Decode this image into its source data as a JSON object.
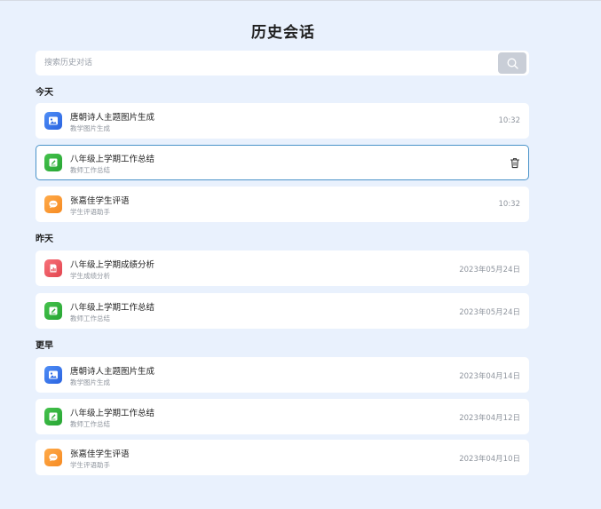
{
  "page": {
    "title": "历史会话"
  },
  "search": {
    "placeholder": "搜索历史对话"
  },
  "sections": [
    {
      "label": "今天",
      "items": [
        {
          "title": "唐朝诗人主题图片生成",
          "subtitle": "教学图片生成",
          "time": "10:32",
          "icon": "image-icon",
          "color": "#3b7bf0"
        },
        {
          "title": "八年级上学期工作总结",
          "subtitle": "教师工作总结",
          "time": "",
          "icon": "edit-icon",
          "color": "#36b540",
          "selected": true
        },
        {
          "title": "张嘉佳学生评语",
          "subtitle": "学生评语助手",
          "time": "10:32",
          "icon": "chat-icon",
          "color": "#f99a35"
        }
      ]
    },
    {
      "label": "昨天",
      "items": [
        {
          "title": "八年级上学期成绩分析",
          "subtitle": "学生成绩分析",
          "time": "2023年05月24日",
          "icon": "chart-icon",
          "color": "#ec5a63"
        },
        {
          "title": "八年级上学期工作总结",
          "subtitle": "教师工作总结",
          "time": "2023年05月24日",
          "icon": "edit-icon",
          "color": "#36b540"
        }
      ]
    },
    {
      "label": "更早",
      "items": [
        {
          "title": "唐朝诗人主题图片生成",
          "subtitle": "教学图片生成",
          "time": "2023年04月14日",
          "icon": "image-icon",
          "color": "#3b7bf0"
        },
        {
          "title": "八年级上学期工作总结",
          "subtitle": "教师工作总结",
          "time": "2023年04月12日",
          "icon": "edit-icon",
          "color": "#36b540"
        },
        {
          "title": "张嘉佳学生评语",
          "subtitle": "学生评语助手",
          "time": "2023年04月10日",
          "icon": "chat-icon",
          "color": "#f99a35"
        }
      ]
    }
  ]
}
